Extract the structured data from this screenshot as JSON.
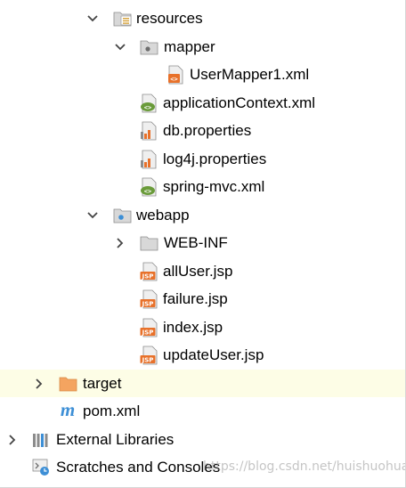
{
  "tree": {
    "resources": "resources",
    "mapper": "mapper",
    "usermapper": "UserMapper1.xml",
    "appcontext": "applicationContext.xml",
    "dbprops": "db.properties",
    "log4j": "log4j.properties",
    "springmvc": "spring-mvc.xml",
    "webapp": "webapp",
    "webinf": "WEB-INF",
    "alluser": "allUser.jsp",
    "failure": "failure.jsp",
    "index": "index.jsp",
    "updateuser": "updateUser.jsp",
    "target": "target",
    "pom": "pom.xml",
    "extlibs": "External Libraries",
    "scratches": "Scratches and Consoles"
  },
  "icons": {
    "jsp_badge": "JSP",
    "xml_badge": "<>",
    "maven_glyph": "m"
  },
  "watermark": "https://blog.csdn.net/huishuohua",
  "colors": {
    "selected_row": "#fdfde6",
    "folder_orange": "#f4a460",
    "jsp_orange": "#e8712a",
    "xml_green": "#6a9b3a",
    "maven_blue": "#3d8fd6"
  }
}
